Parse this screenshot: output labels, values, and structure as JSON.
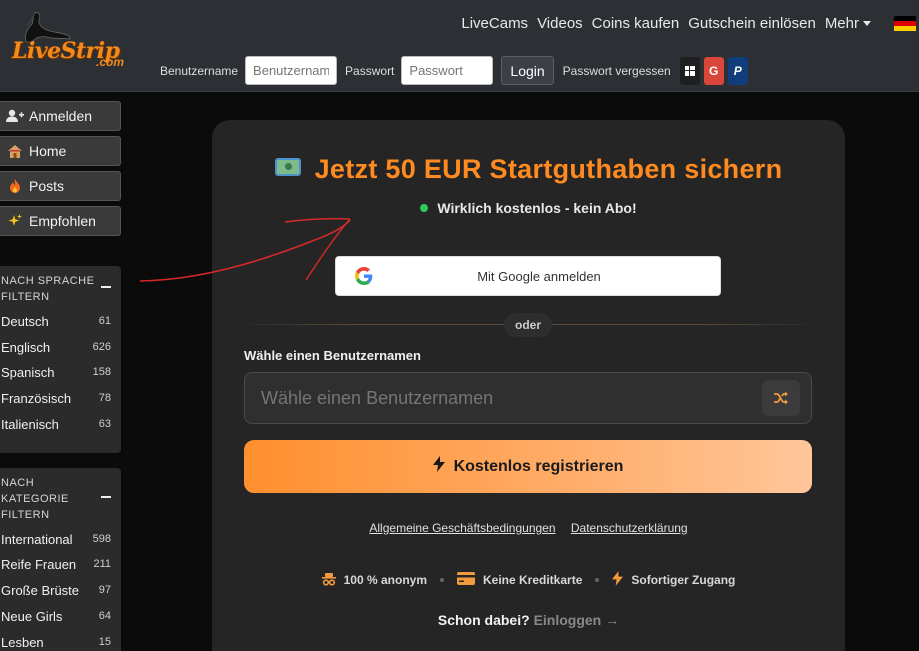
{
  "header": {
    "logo_text": "LiveStrip",
    "logo_suffix": ".com",
    "nav": [
      "LiveCams",
      "Videos",
      "Coins kaufen",
      "Gutschein einlösen",
      "Mehr"
    ],
    "flag_colors": [
      "#000000",
      "#dd0000",
      "#ffce00"
    ]
  },
  "login": {
    "username_label": "Benutzername",
    "username_placeholder": "Benutzername",
    "password_label": "Passwort",
    "password_placeholder": "Passwort",
    "login_button": "Login",
    "forgot_password": "Passwort vergessen",
    "sso": [
      "windows-icon",
      "google-icon",
      "paypal-icon"
    ],
    "google_letter": "G",
    "paypal_letter": "P"
  },
  "sidebar": {
    "buttons": [
      {
        "label": "Anmelden",
        "icon": "add-user-icon"
      },
      {
        "label": "Home",
        "icon": "house-icon"
      },
      {
        "label": "Posts",
        "icon": "fire-icon"
      },
      {
        "label": "Empfohlen",
        "icon": "sparkles-icon"
      }
    ],
    "language_filter": {
      "title": "NACH SPRACHE FILTERN",
      "items": [
        {
          "label": "Deutsch",
          "count": "61"
        },
        {
          "label": "Englisch",
          "count": "626"
        },
        {
          "label": "Spanisch",
          "count": "158"
        },
        {
          "label": "Französisch",
          "count": "78"
        },
        {
          "label": "Italienisch",
          "count": "63"
        }
      ]
    },
    "category_filter": {
      "title": "NACH KATEGORIE FILTERN",
      "items": [
        {
          "label": "International",
          "count": "598"
        },
        {
          "label": "Reife Frauen",
          "count": "211"
        },
        {
          "label": "Große Brüste",
          "count": "97"
        },
        {
          "label": "Neue Girls",
          "count": "64"
        },
        {
          "label": "Lesben",
          "count": "15"
        }
      ]
    }
  },
  "main": {
    "headline": "Jetzt 50 EUR Startguthaben sichern",
    "subline": "Wirklich kostenlos - kein Abo!",
    "google_button": "Mit Google anmelden",
    "divider_text": "oder",
    "username_label": "Wähle einen Benutzernamen",
    "username_placeholder": "Wähle einen Benutzernamen",
    "register_button": "Kostenlos registrieren",
    "terms_link": "Allgemeine Geschäftsbedingungen",
    "privacy_link": "Datenschutzerklärung",
    "features": [
      {
        "label": "100 % anonym",
        "icon": "incognito-icon"
      },
      {
        "label": "Keine Kreditkarte",
        "icon": "credit-card-icon"
      },
      {
        "label": "Sofortiger Zugang",
        "icon": "bolt-icon"
      }
    ],
    "already_prefix": "Schon dabei?",
    "already_link": "Einloggen"
  },
  "colors": {
    "accent": "#ff8a1f",
    "header_bg": "#2c2f33",
    "card_bg": "#252525",
    "status_dot": "#2ecc55",
    "annotation": "#d42a2a"
  }
}
